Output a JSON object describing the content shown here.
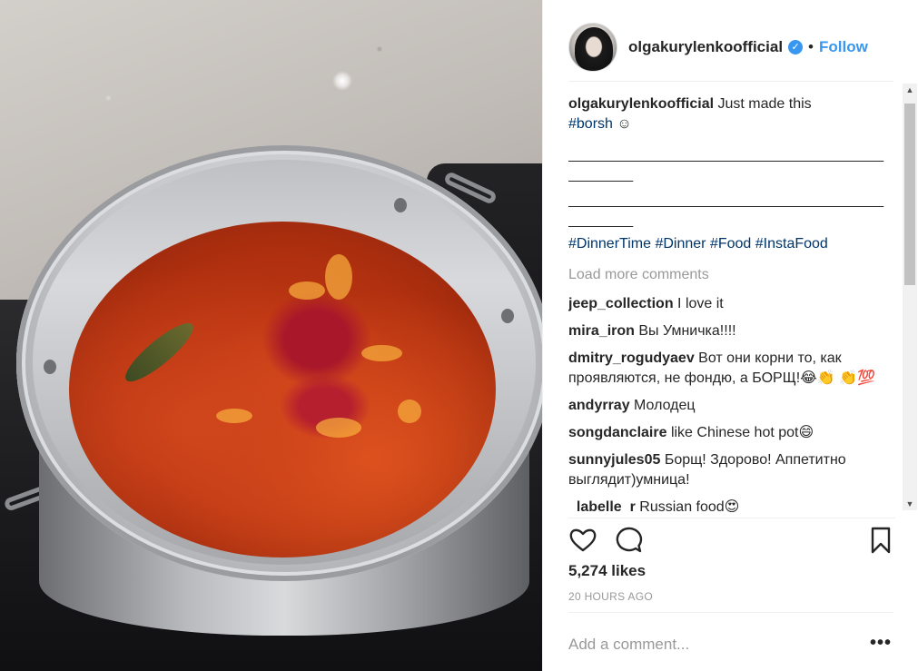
{
  "post": {
    "username": "olgakurylenkoofficial",
    "verified_icon": "verified-badge-icon",
    "separator": "•",
    "follow_label": "Follow",
    "caption": {
      "text": "Just made this",
      "tag": "#borsh",
      "smile": "☺",
      "line1": "_______________________________________",
      "line2": "________",
      "line3": "_______________________________________",
      "line4": "________",
      "hashtags": [
        "#DinnerTime",
        "#Dinner",
        "#Food",
        "#InstaFood"
      ]
    },
    "load_more_label": "Load more comments",
    "comments": [
      {
        "user": "jeep_collection",
        "text": "I love it"
      },
      {
        "user": "mira_iron",
        "text": "Вы Умничка!!!!"
      },
      {
        "user": "dmitry_rogudyaev",
        "text": "Вот они корни то, как проявляются, не фондю, а БОРЩ!😂👏 👏💯"
      },
      {
        "user": "andyrray",
        "text": "Молодец"
      },
      {
        "user": "songdanclaire",
        "text": "like Chinese hot pot😄"
      },
      {
        "user": "sunnyjules05",
        "text": "Борщ! Здорово! Аппетитно выглядит)умница!"
      },
      {
        "user": "_labelle_r",
        "text": "Russian food😍"
      }
    ],
    "likes": "5,274 likes",
    "time": "20 HOURS AGO",
    "add_comment_placeholder": "Add a comment...",
    "more_label": "•••",
    "icons": {
      "like": "heart-icon",
      "comment": "comment-bubble-icon",
      "save": "bookmark-icon"
    },
    "colors": {
      "link": "#3897f0",
      "hashtag": "#003569",
      "muted": "#999999",
      "text": "#262626"
    }
  },
  "scrollbar": {
    "up_arrow": "▲",
    "down_arrow": "▼"
  }
}
